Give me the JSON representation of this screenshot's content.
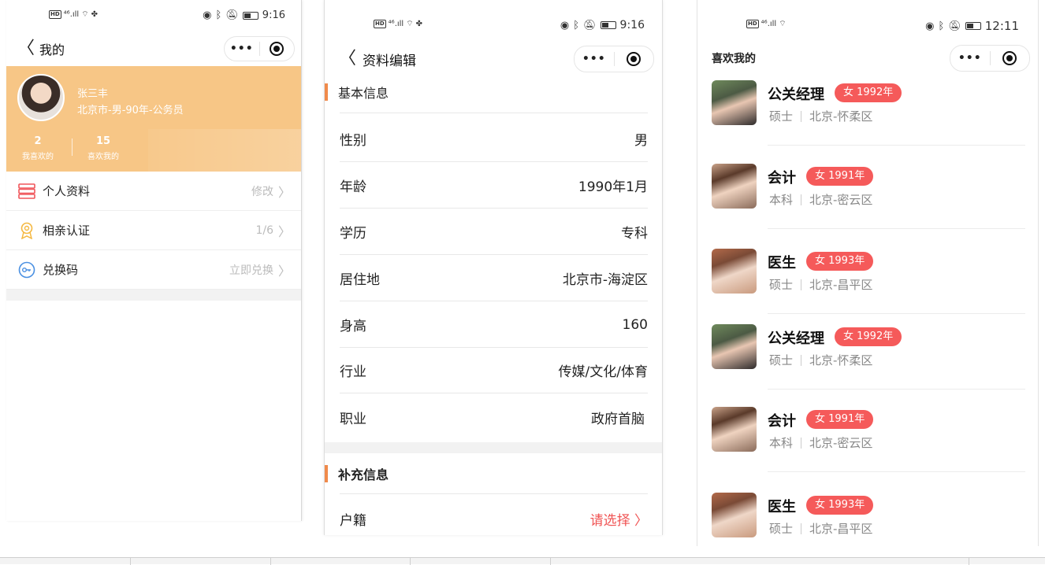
{
  "phone1": {
    "status": {
      "time": "9:16",
      "signal": "⁴⁶.ıll",
      "wifi": "⋒",
      "chat": "🙭"
    },
    "nav": {
      "back": "〈",
      "title": "我的"
    },
    "profile": {
      "name": "张三丰",
      "info": "北京市-男-90年-公务员"
    },
    "stats": [
      {
        "num": "2",
        "label": "我喜欢的"
      },
      {
        "num": "15",
        "label": "喜欢我的"
      }
    ],
    "menu": [
      {
        "label": "个人资料",
        "value": "修改",
        "icon": "profile-list-icon"
      },
      {
        "label": "相亲认证",
        "value": "1/6",
        "icon": "badge-icon"
      },
      {
        "label": "兑换码",
        "value": "立即兑换",
        "icon": "key-icon"
      }
    ]
  },
  "phone2": {
    "status": {
      "time": "9:16"
    },
    "nav": {
      "back": "〈",
      "title": "资料编辑"
    },
    "basic_title": "基本信息",
    "basic_rows": [
      {
        "key": "性别",
        "value": "男"
      },
      {
        "key": "年龄",
        "value": "1990年1月"
      },
      {
        "key": "学历",
        "value": "专科"
      },
      {
        "key": "居住地",
        "value": "北京市-海淀区"
      },
      {
        "key": "身高",
        "value": "160"
      },
      {
        "key": "行业",
        "value": "传媒/文化/体育"
      },
      {
        "key": "职业",
        "value": "政府首脑"
      }
    ],
    "extra_title": "补充信息",
    "extra_rows": [
      {
        "key": "户籍",
        "value": "请选择 〉"
      }
    ]
  },
  "phone3": {
    "status": {
      "time": "12:11"
    },
    "title": "喜欢我的",
    "cards": [
      {
        "job": "公关经理",
        "tag": "女  1992年",
        "edu": "硕士",
        "loc": "北京-怀柔区"
      },
      {
        "job": "会计",
        "tag": "女  1991年",
        "edu": "本科",
        "loc": "北京-密云区"
      },
      {
        "job": "医生",
        "tag": "女  1993年",
        "edu": "硕士",
        "loc": "北京-昌平区"
      },
      {
        "job": "公关经理",
        "tag": "女  1992年",
        "edu": "硕士",
        "loc": "北京-怀柔区"
      },
      {
        "job": "会计",
        "tag": "女  1991年",
        "edu": "本科",
        "loc": "北京-密云区"
      },
      {
        "job": "医生",
        "tag": "女  1993年",
        "edu": "硕士",
        "loc": "北京-昌平区"
      }
    ]
  },
  "capsule": {
    "dots": "•••"
  },
  "colors": {
    "accent": "#f7c686",
    "tag": "#f55a5a",
    "section_bar": "#f08a4b"
  }
}
